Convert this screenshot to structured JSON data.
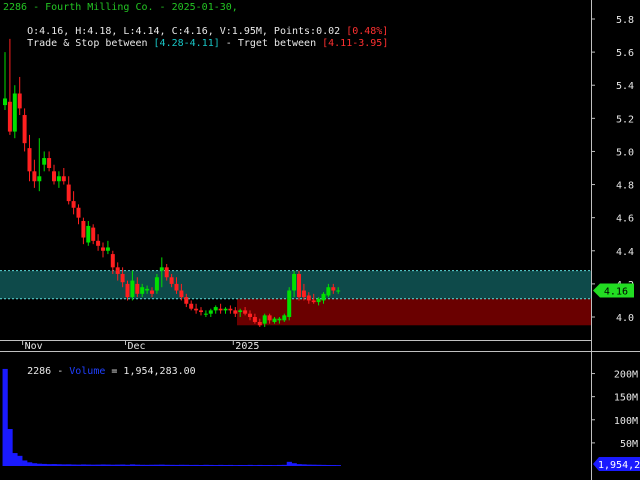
{
  "header": {
    "title_line": "2286 - Fourth Milling Co. - 2025-01-30,",
    "ohlc_text": "O:4.16, H:4.18, L:4.14, C:4.16, V:1.95M, Points:0.02 ",
    "change_text": "[0.48%]",
    "trade_prefix": "Trade & Stop between ",
    "trade_range": "[4.28-4.11]",
    "target_prefix": " - Trget between ",
    "target_range": "[4.11-3.95]"
  },
  "price_axis": {
    "ticks": [
      "5.8",
      "5.6",
      "5.4",
      "5.2",
      "5.0",
      "4.8",
      "4.6",
      "4.4",
      "4.2",
      "4.0"
    ],
    "last_price_label": "4.16"
  },
  "time_axis": {
    "labels": [
      "Nov",
      "Dec",
      "2025"
    ]
  },
  "volume_panel": {
    "label_prefix": "2286 - ",
    "label_name": "Volume",
    "label_value": " = 1,954,283.00",
    "ticks": [
      "200M",
      "150M",
      "100M",
      "50M"
    ],
    "last_volume_label": "1,954,283"
  },
  "colors": {
    "up_candle": "#00e000",
    "down_candle": "#ff2020",
    "trade_zone": "#0e4a4a",
    "target_zone": "#6a0000",
    "zone_line": "#60e0e0",
    "volume": "#1a1aff",
    "axis_text": "#e8e8e8"
  },
  "chart_data": [
    {
      "type": "candlestick",
      "title": "2286 - Fourth Milling Co. - 2025-01-30,",
      "ylim": [
        3.9,
        5.95
      ],
      "x_tick_labels": [
        "Nov",
        "Dec",
        "2025"
      ],
      "y_tick_labels": [
        "5.8",
        "5.6",
        "5.4",
        "5.2",
        "5.0",
        "4.8",
        "4.6",
        "4.4",
        "4.2",
        "4.0"
      ],
      "trade_stop_zone": [
        4.11,
        4.28
      ],
      "target_zone": [
        3.95,
        4.11
      ],
      "last_close": 4.16,
      "candles": [
        {
          "o": 5.28,
          "h": 5.6,
          "l": 5.25,
          "c": 5.32
        },
        {
          "o": 5.3,
          "h": 5.68,
          "l": 5.1,
          "c": 5.12
        },
        {
          "o": 5.12,
          "h": 5.4,
          "l": 5.08,
          "c": 5.35
        },
        {
          "o": 5.35,
          "h": 5.45,
          "l": 5.22,
          "c": 5.26
        },
        {
          "o": 5.22,
          "h": 5.26,
          "l": 5.0,
          "c": 5.05
        },
        {
          "o": 5.02,
          "h": 5.1,
          "l": 4.82,
          "c": 4.88
        },
        {
          "o": 4.88,
          "h": 4.95,
          "l": 4.78,
          "c": 4.82
        },
        {
          "o": 4.82,
          "h": 5.08,
          "l": 4.76,
          "c": 4.85
        },
        {
          "o": 4.92,
          "h": 5.0,
          "l": 4.88,
          "c": 4.96
        },
        {
          "o": 4.96,
          "h": 5.0,
          "l": 4.88,
          "c": 4.9
        },
        {
          "o": 4.88,
          "h": 4.92,
          "l": 4.8,
          "c": 4.82
        },
        {
          "o": 4.82,
          "h": 4.88,
          "l": 4.78,
          "c": 4.85
        },
        {
          "o": 4.85,
          "h": 4.9,
          "l": 4.8,
          "c": 4.82
        },
        {
          "o": 4.8,
          "h": 4.85,
          "l": 4.68,
          "c": 4.7
        },
        {
          "o": 4.7,
          "h": 4.76,
          "l": 4.62,
          "c": 4.66
        },
        {
          "o": 4.66,
          "h": 4.68,
          "l": 4.56,
          "c": 4.6
        },
        {
          "o": 4.58,
          "h": 4.6,
          "l": 4.44,
          "c": 4.48
        },
        {
          "o": 4.45,
          "h": 4.58,
          "l": 4.43,
          "c": 4.55
        },
        {
          "o": 4.54,
          "h": 4.56,
          "l": 4.44,
          "c": 4.46
        },
        {
          "o": 4.46,
          "h": 4.5,
          "l": 4.4,
          "c": 4.43
        },
        {
          "o": 4.42,
          "h": 4.45,
          "l": 4.36,
          "c": 4.4
        },
        {
          "o": 4.4,
          "h": 4.46,
          "l": 4.38,
          "c": 4.42
        },
        {
          "o": 4.38,
          "h": 4.4,
          "l": 4.26,
          "c": 4.3
        },
        {
          "o": 4.3,
          "h": 4.33,
          "l": 4.22,
          "c": 4.26
        },
        {
          "o": 4.26,
          "h": 4.3,
          "l": 4.18,
          "c": 4.21
        },
        {
          "o": 4.2,
          "h": 4.22,
          "l": 4.1,
          "c": 4.12
        },
        {
          "o": 4.12,
          "h": 4.28,
          "l": 4.1,
          "c": 4.22
        },
        {
          "o": 4.2,
          "h": 4.24,
          "l": 4.12,
          "c": 4.14
        },
        {
          "o": 4.14,
          "h": 4.2,
          "l": 4.12,
          "c": 4.18
        },
        {
          "o": 4.16,
          "h": 4.19,
          "l": 4.14,
          "c": 4.17
        },
        {
          "o": 4.16,
          "h": 4.18,
          "l": 4.12,
          "c": 4.14
        },
        {
          "o": 4.16,
          "h": 4.26,
          "l": 4.14,
          "c": 4.24
        },
        {
          "o": 4.28,
          "h": 4.36,
          "l": 4.18,
          "c": 4.3
        },
        {
          "o": 4.3,
          "h": 4.32,
          "l": 4.22,
          "c": 4.24
        },
        {
          "o": 4.24,
          "h": 4.26,
          "l": 4.18,
          "c": 4.2
        },
        {
          "o": 4.2,
          "h": 4.24,
          "l": 4.14,
          "c": 4.16
        },
        {
          "o": 4.16,
          "h": 4.2,
          "l": 4.1,
          "c": 4.12
        },
        {
          "o": 4.12,
          "h": 4.14,
          "l": 4.06,
          "c": 4.08
        },
        {
          "o": 4.08,
          "h": 4.1,
          "l": 4.04,
          "c": 4.05
        },
        {
          "o": 4.05,
          "h": 4.08,
          "l": 4.02,
          "c": 4.04
        },
        {
          "o": 4.04,
          "h": 4.06,
          "l": 4.01,
          "c": 4.03
        },
        {
          "o": 4.02,
          "h": 4.04,
          "l": 4.0,
          "c": 4.02
        },
        {
          "o": 4.02,
          "h": 4.05,
          "l": 4.0,
          "c": 4.04
        },
        {
          "o": 4.04,
          "h": 4.07,
          "l": 4.02,
          "c": 4.06
        },
        {
          "o": 4.05,
          "h": 4.08,
          "l": 4.02,
          "c": 4.04
        },
        {
          "o": 4.04,
          "h": 4.06,
          "l": 4.02,
          "c": 4.05
        },
        {
          "o": 4.05,
          "h": 4.07,
          "l": 4.02,
          "c": 4.04
        },
        {
          "o": 4.04,
          "h": 4.06,
          "l": 4.0,
          "c": 4.02
        },
        {
          "o": 4.03,
          "h": 4.05,
          "l": 4.0,
          "c": 4.04
        },
        {
          "o": 4.04,
          "h": 4.06,
          "l": 4.01,
          "c": 4.02
        },
        {
          "o": 4.02,
          "h": 4.04,
          "l": 3.98,
          "c": 4.0
        },
        {
          "o": 4.0,
          "h": 4.02,
          "l": 3.96,
          "c": 3.97
        },
        {
          "o": 3.97,
          "h": 3.99,
          "l": 3.94,
          "c": 3.95
        },
        {
          "o": 3.96,
          "h": 4.02,
          "l": 3.94,
          "c": 4.01
        },
        {
          "o": 4.01,
          "h": 4.02,
          "l": 3.96,
          "c": 3.98
        },
        {
          "o": 3.97,
          "h": 4.0,
          "l": 3.96,
          "c": 3.99
        },
        {
          "o": 3.98,
          "h": 4.0,
          "l": 3.96,
          "c": 3.99
        },
        {
          "o": 3.98,
          "h": 4.02,
          "l": 3.97,
          "c": 4.01
        },
        {
          "o": 4.0,
          "h": 4.18,
          "l": 3.98,
          "c": 4.16
        },
        {
          "o": 4.16,
          "h": 4.28,
          "l": 4.12,
          "c": 4.26
        },
        {
          "o": 4.26,
          "h": 4.28,
          "l": 4.1,
          "c": 4.12
        },
        {
          "o": 4.16,
          "h": 4.2,
          "l": 4.1,
          "c": 4.12
        },
        {
          "o": 4.13,
          "h": 4.15,
          "l": 4.08,
          "c": 4.1
        },
        {
          "o": 4.1,
          "h": 4.14,
          "l": 4.08,
          "c": 4.09
        },
        {
          "o": 4.09,
          "h": 4.12,
          "l": 4.07,
          "c": 4.11
        },
        {
          "o": 4.1,
          "h": 4.15,
          "l": 4.08,
          "c": 4.14
        },
        {
          "o": 4.13,
          "h": 4.2,
          "l": 4.12,
          "c": 4.18
        },
        {
          "o": 4.18,
          "h": 4.2,
          "l": 4.14,
          "c": 4.16
        },
        {
          "o": 4.16,
          "h": 4.18,
          "l": 4.14,
          "c": 4.16
        }
      ]
    },
    {
      "type": "bar",
      "title": "2286 - Volume = 1,954,283.00",
      "ylim": [
        0,
        225000000
      ],
      "y_tick_labels": [
        "200M",
        "150M",
        "100M",
        "50M"
      ],
      "values": [
        210000000,
        80000000,
        28000000,
        22000000,
        12000000,
        8000000,
        6000000,
        5000000,
        4500000,
        4000000,
        4200000,
        3800000,
        3500000,
        3600000,
        3200000,
        3000000,
        3400000,
        3100000,
        2900000,
        3000000,
        3300000,
        3100000,
        2800000,
        3000000,
        3200000,
        2700000,
        3500000,
        2900000,
        2600000,
        2500000,
        2700000,
        2800000,
        3000000,
        2600000,
        2500000,
        2400000,
        2600000,
        2500000,
        2300000,
        2400000,
        2200000,
        2500000,
        2300000,
        2100000,
        2400000,
        2200000,
        2300000,
        2000000,
        2200000,
        2100000,
        2400000,
        2000000,
        2300000,
        2100000,
        2200000,
        2000000,
        2300000,
        2500000,
        9000000,
        6000000,
        4000000,
        3500000,
        3000000,
        2800000,
        2600000,
        2400000,
        2200000,
        2100000,
        1954283
      ]
    }
  ]
}
